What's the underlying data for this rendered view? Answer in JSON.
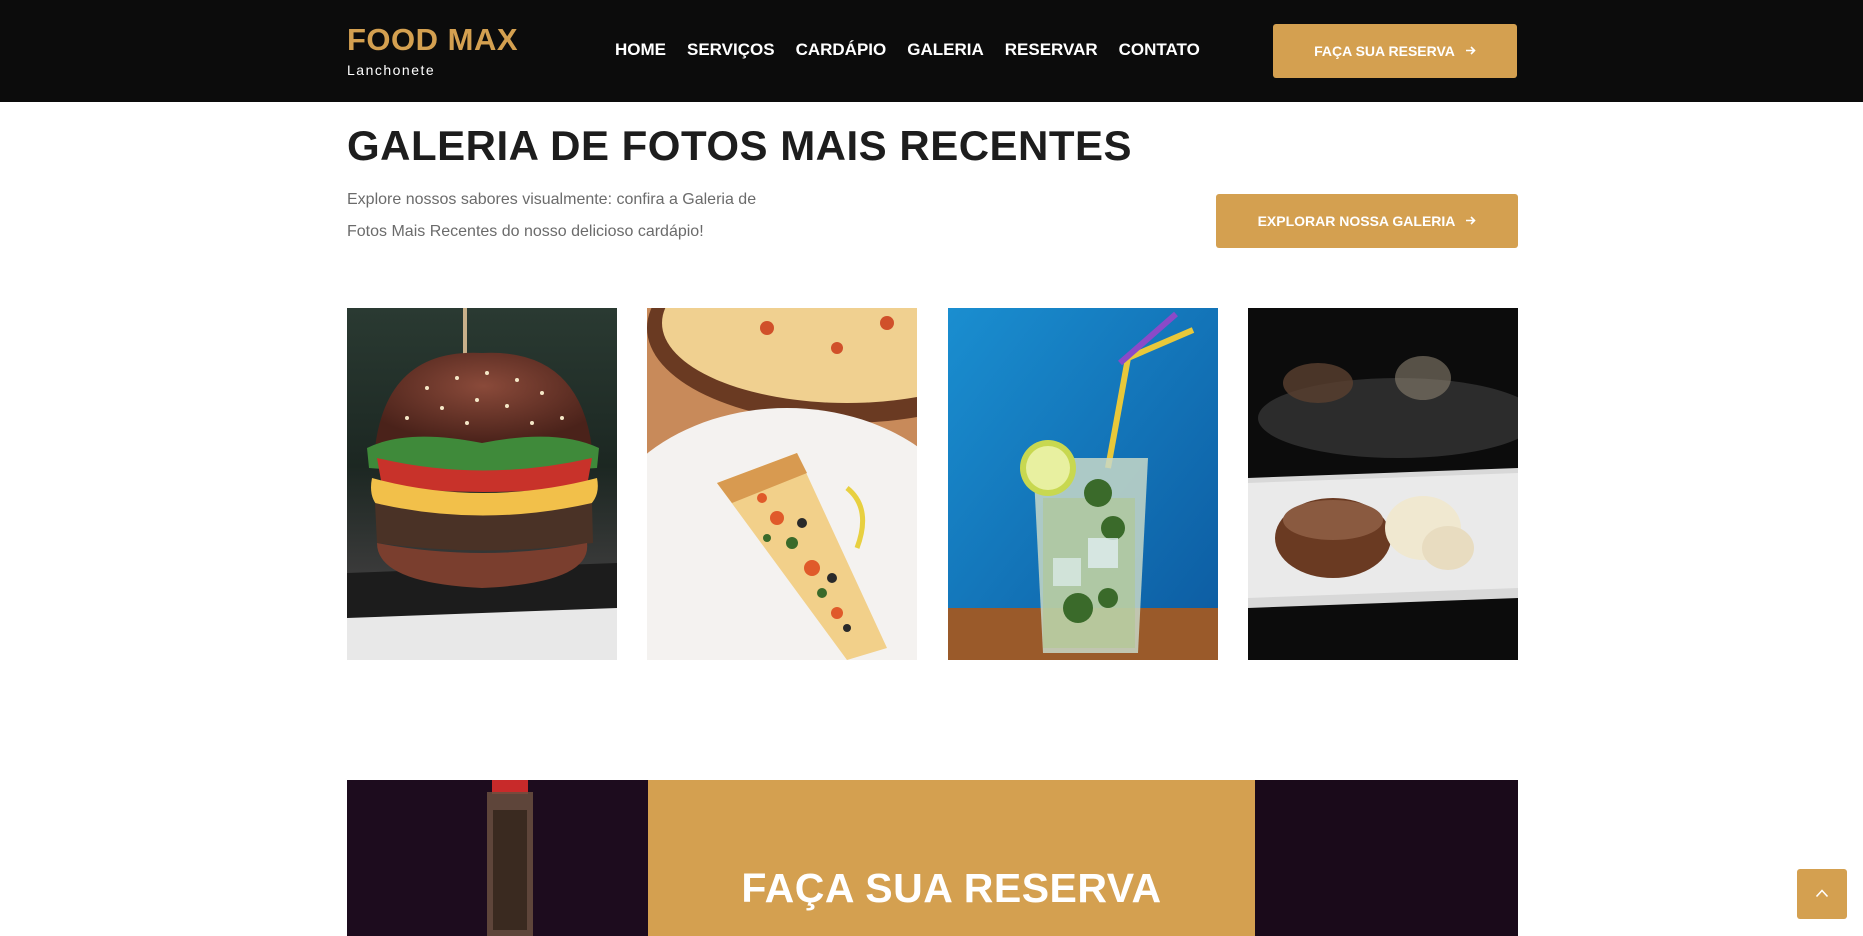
{
  "header": {
    "brand": "FOOD MAX",
    "tagline": "Lanchonete",
    "nav": [
      "HOME",
      "SERVIÇOS",
      "CARDÁPIO",
      "GALERIA",
      "RESERVAR",
      "CONTATO"
    ],
    "cta": "FAÇA SUA RESERVA"
  },
  "gallery": {
    "title": "GALERIA DE FOTOS MAIS RECENTES",
    "description": "Explore nossos sabores visualmente: confira a Galeria de Fotos Mais Recentes do nosso delicioso cardápio!",
    "button": "EXPLORAR NOSSA GALERIA"
  },
  "reservation": {
    "title": "FAÇA SUA RESERVA"
  },
  "colors": {
    "accent": "#d4a050",
    "navbar": "#0c0c0c",
    "heading": "#1d1d1d"
  },
  "icons": [
    "arrow-right-icon",
    "chevron-up-icon"
  ]
}
